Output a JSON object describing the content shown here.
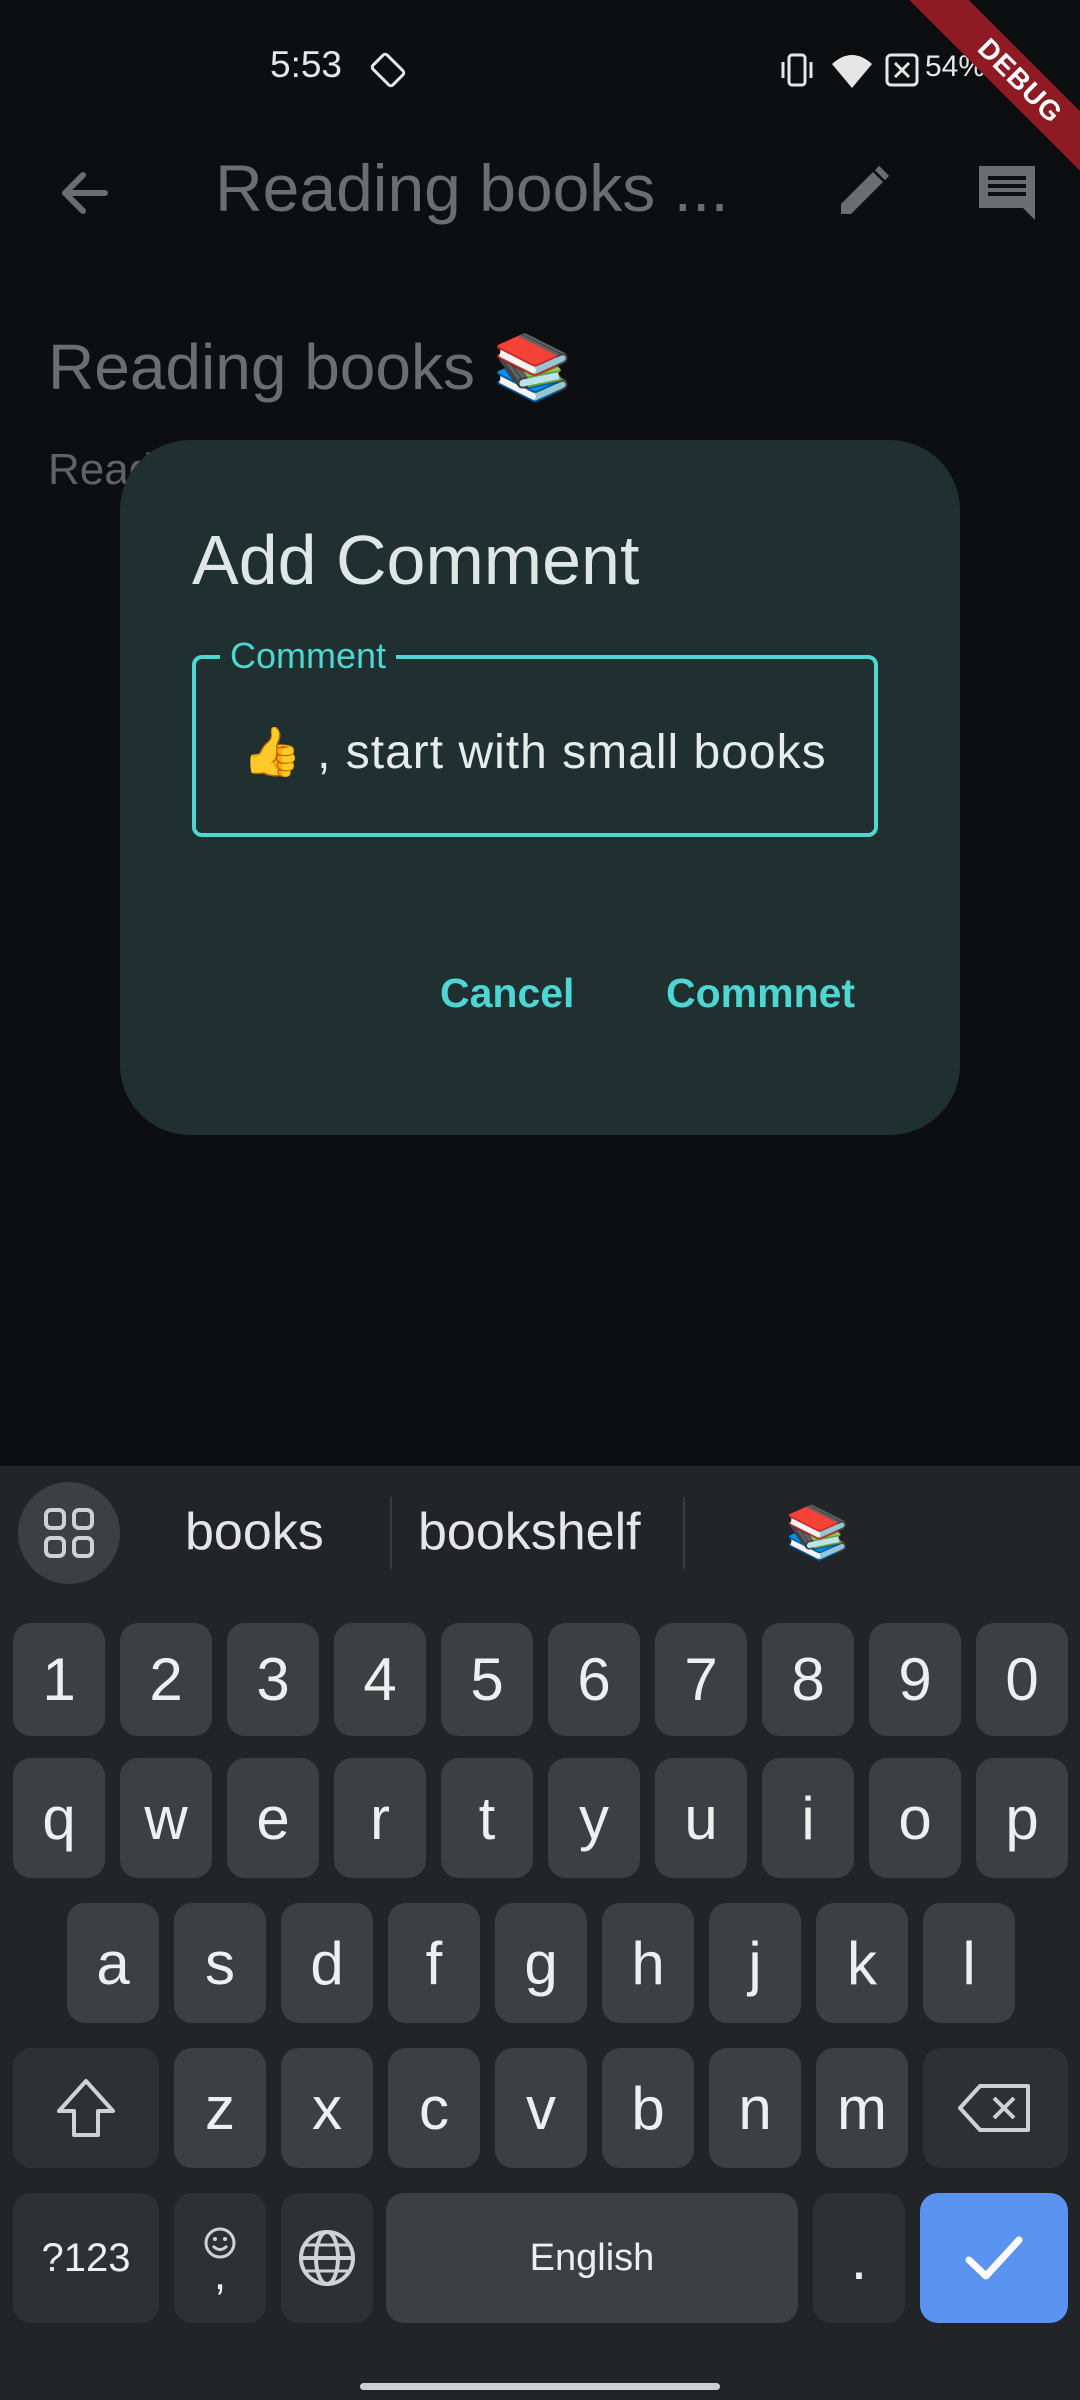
{
  "status_bar": {
    "time": "5:53",
    "battery": "54%",
    "debug_banner": "DEBUG"
  },
  "app_bar": {
    "title": "Reading books ..."
  },
  "background": {
    "title": "Reading books 📚",
    "subtitle_partial": "Read"
  },
  "dialog": {
    "title": "Add Comment",
    "field_label": "Comment",
    "field_value": "👍 , start with small books",
    "cancel_label": "Cancel",
    "submit_label": "Commnet"
  },
  "keyboard": {
    "suggestions": [
      "books",
      "bookshelf",
      "📚"
    ],
    "row_numbers": [
      "1",
      "2",
      "3",
      "4",
      "5",
      "6",
      "7",
      "8",
      "9",
      "0"
    ],
    "row_1": [
      "q",
      "w",
      "e",
      "r",
      "t",
      "y",
      "u",
      "i",
      "o",
      "p"
    ],
    "row_2": [
      "a",
      "s",
      "d",
      "f",
      "g",
      "h",
      "j",
      "k",
      "l"
    ],
    "row_3": [
      "z",
      "x",
      "c",
      "v",
      "b",
      "n",
      "m"
    ],
    "symbols_key": "?123",
    "comma_key": ",",
    "space_label": "English",
    "period_key": "."
  },
  "colors": {
    "accent": "#4dd6d2",
    "dialog_bg": "#202f30",
    "keyboard_bg": "#222528",
    "enter_key": "#5b93f0",
    "debug_banner": "#8e1a24"
  }
}
